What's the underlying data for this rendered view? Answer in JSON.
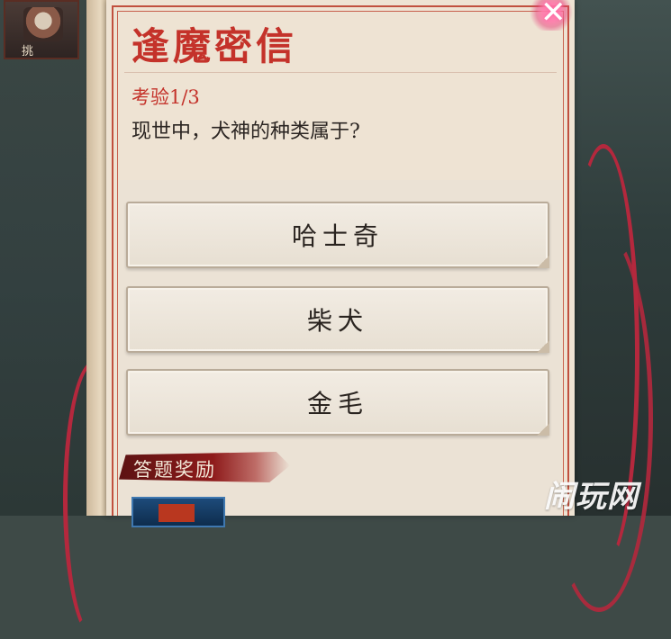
{
  "background": {
    "top_left_widget_label": "挑"
  },
  "dialog": {
    "title": "逢魔密信",
    "round_label": "考验1/3",
    "question": "现世中，犬神的种类属于?",
    "options": [
      {
        "label": "哈士奇"
      },
      {
        "label": "柴犬"
      },
      {
        "label": "金毛"
      }
    ],
    "reward_label": "答题奖励",
    "close_icon": "close-icon"
  },
  "watermark": "闹玩网",
  "colors": {
    "title_red": "#c4322a",
    "rope_red": "#b4283d",
    "paper": "#eee3d3"
  }
}
